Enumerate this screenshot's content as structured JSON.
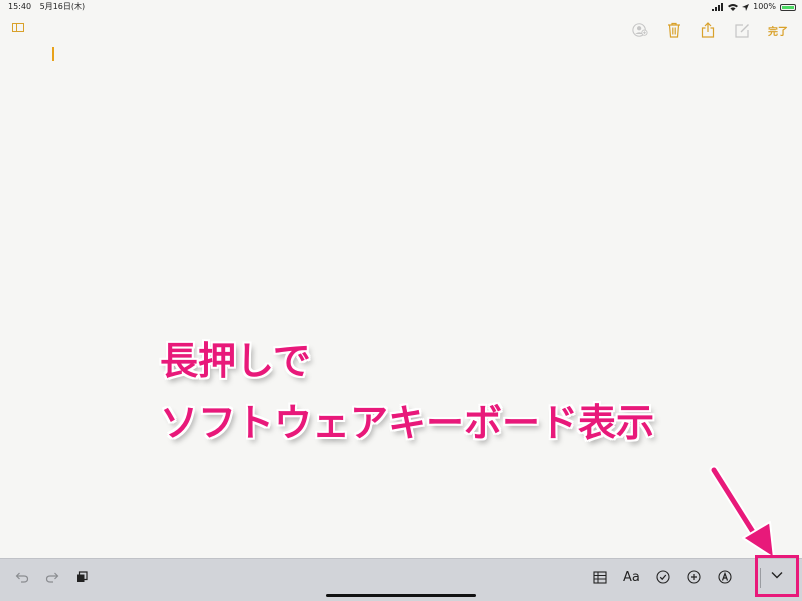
{
  "status_bar": {
    "time": "15:40",
    "date": "5月16日(木)",
    "battery_percent": "100%"
  },
  "nav": {
    "done_label": "完了"
  },
  "annotation": {
    "line1": "長押しで",
    "line2": "ソフトウェアキーボード表示"
  },
  "toolbar": {
    "format_label": "Aa"
  },
  "colors": {
    "accent": "#d9a12a",
    "annotation": "#e8197a",
    "toolbar_bg": "#d2d4d9"
  }
}
